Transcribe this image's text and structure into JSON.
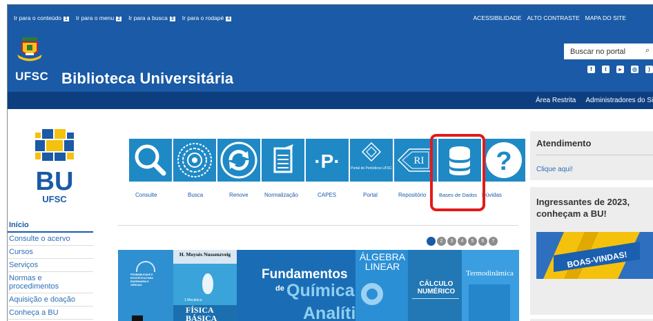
{
  "header": {
    "skip_links": [
      {
        "label": "Ir para o conteúdo",
        "key": "1"
      },
      {
        "label": "Ir para o menu",
        "key": "2"
      },
      {
        "label": "Ir para a busca",
        "key": "3"
      },
      {
        "label": "Ir para o rodapé",
        "key": "4"
      }
    ],
    "top_links": [
      "ACESSIBILIDADE",
      "ALTO CONTRASTE",
      "MAPA DO SITE"
    ],
    "ufsc": "UFSC",
    "site_title": "Biblioteca Universitária",
    "search_placeholder": "Buscar no portal",
    "colors": {
      "primary": "#1a5aa6",
      "dark": "#0d3f80",
      "highlight": "#e21a1a"
    }
  },
  "subbar": {
    "links": [
      "Área Restrita",
      "Administradores do Site"
    ]
  },
  "sidebar": {
    "logo_text": "BU",
    "logo_sub": "UFSC",
    "items": [
      "Início",
      "Consulte o acervo",
      "Cursos",
      "Serviços",
      "Normas e procedimentos",
      "Aquisição e doação",
      "Conheça a BU"
    ]
  },
  "services": {
    "labels": [
      "Consulte",
      "Busca",
      "Renove",
      "Normalização",
      "CAPES",
      "Portal",
      "Repositório",
      "Bases de Dados",
      "Dúvidas"
    ],
    "portal_tile_text": "Portal de Periódicos UFSC",
    "ri_tile_text": "RI",
    "capes_tile_text": "·P·"
  },
  "carousel": {
    "pages": [
      "1",
      "2",
      "3",
      "4",
      "5",
      "6",
      "7"
    ],
    "active": "1"
  },
  "books": {
    "b1_text": "PROBABILIDADE E ESTATÍSTICA PARA ENGENHARIA E CIÊNCIAS",
    "b2_author": "H. Moysés Nussenzveig",
    "b2_vol": "1 Mecânica",
    "b2_title": "FÍSICA BÁSICA",
    "b3_title_1": "Fundamentos",
    "b3_title_2": "de",
    "b3_title_3": "Química",
    "b3_title_4": "Analítica",
    "b4_title": "ÁLGEBRA LINEAR",
    "b5_title": "CÁLCULO NUMÉRICO",
    "b6_title": "Termodinâmica"
  },
  "right": {
    "atendimento_title": "Atendimento",
    "atendimento_link": "Clique aqui!",
    "ingressantes_title": "Ingressantes de 2023, conheçam a BU!",
    "banner_text": "BOAS-VINDAS!"
  }
}
